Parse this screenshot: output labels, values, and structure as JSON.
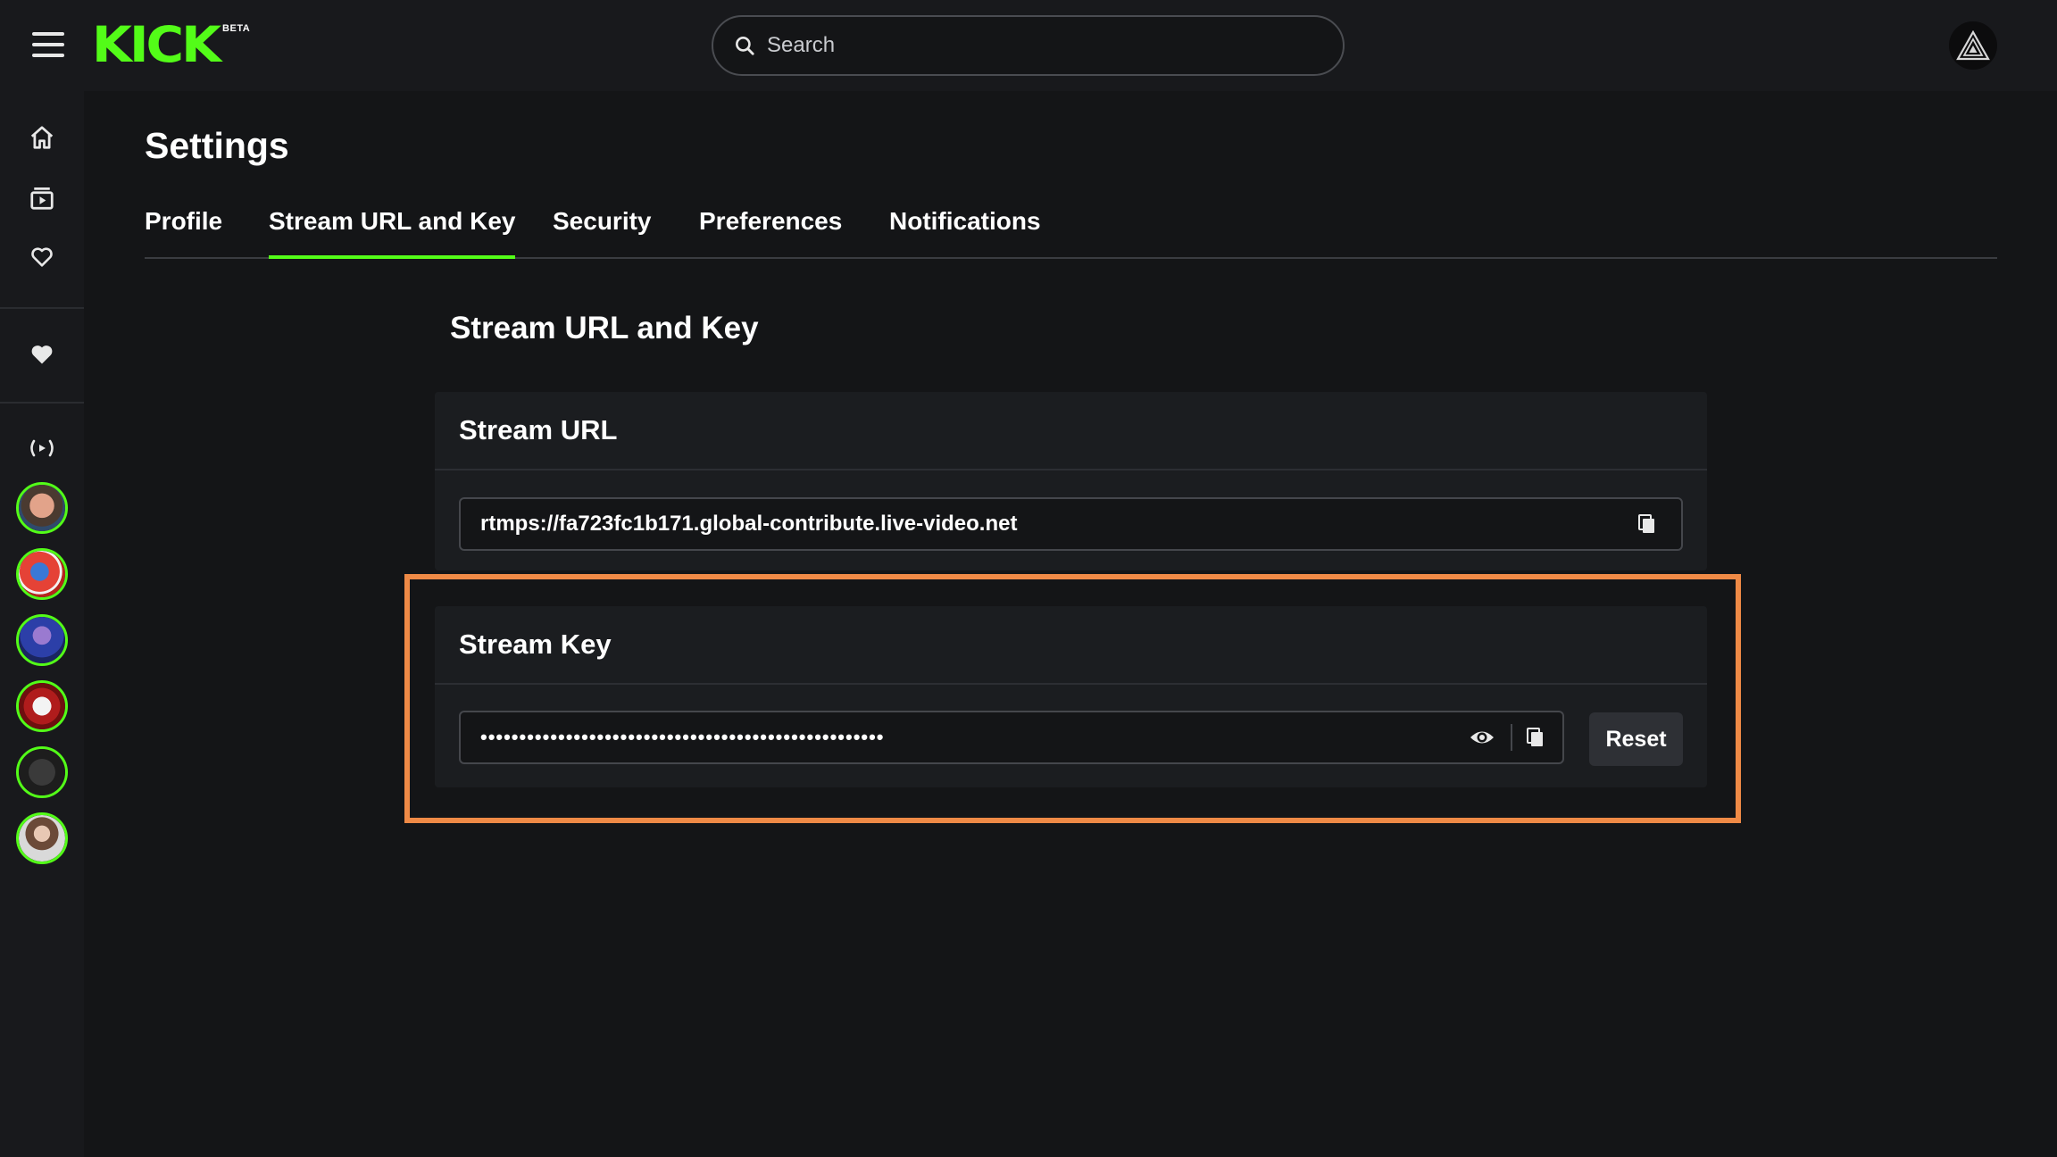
{
  "header": {
    "logo_text": "KICK",
    "logo_badge": "BETA",
    "search_placeholder": "Search",
    "brand_color": "#53fc18"
  },
  "sidebar": {
    "nav_icons": [
      "home-icon",
      "browse-icon",
      "following-icon",
      "favorites-icon",
      "live-icon"
    ],
    "channels_count": 6
  },
  "page": {
    "title": "Settings",
    "tabs": [
      {
        "label": "Profile",
        "active": false
      },
      {
        "label": "Stream URL and Key",
        "active": true
      },
      {
        "label": "Security",
        "active": false
      },
      {
        "label": "Preferences",
        "active": false
      },
      {
        "label": "Notifications",
        "active": false
      }
    ],
    "section_title": "Stream URL and Key"
  },
  "stream_url": {
    "heading": "Stream URL",
    "value": "rtmps://fa723fc1b171.global-contribute.live-video.net"
  },
  "stream_key": {
    "heading": "Stream Key",
    "masked_value": "••••••••••••••••••••••••••••••••••••••••••••••••••••",
    "reset_label": "Reset"
  },
  "highlight_color": "#ef8a46"
}
